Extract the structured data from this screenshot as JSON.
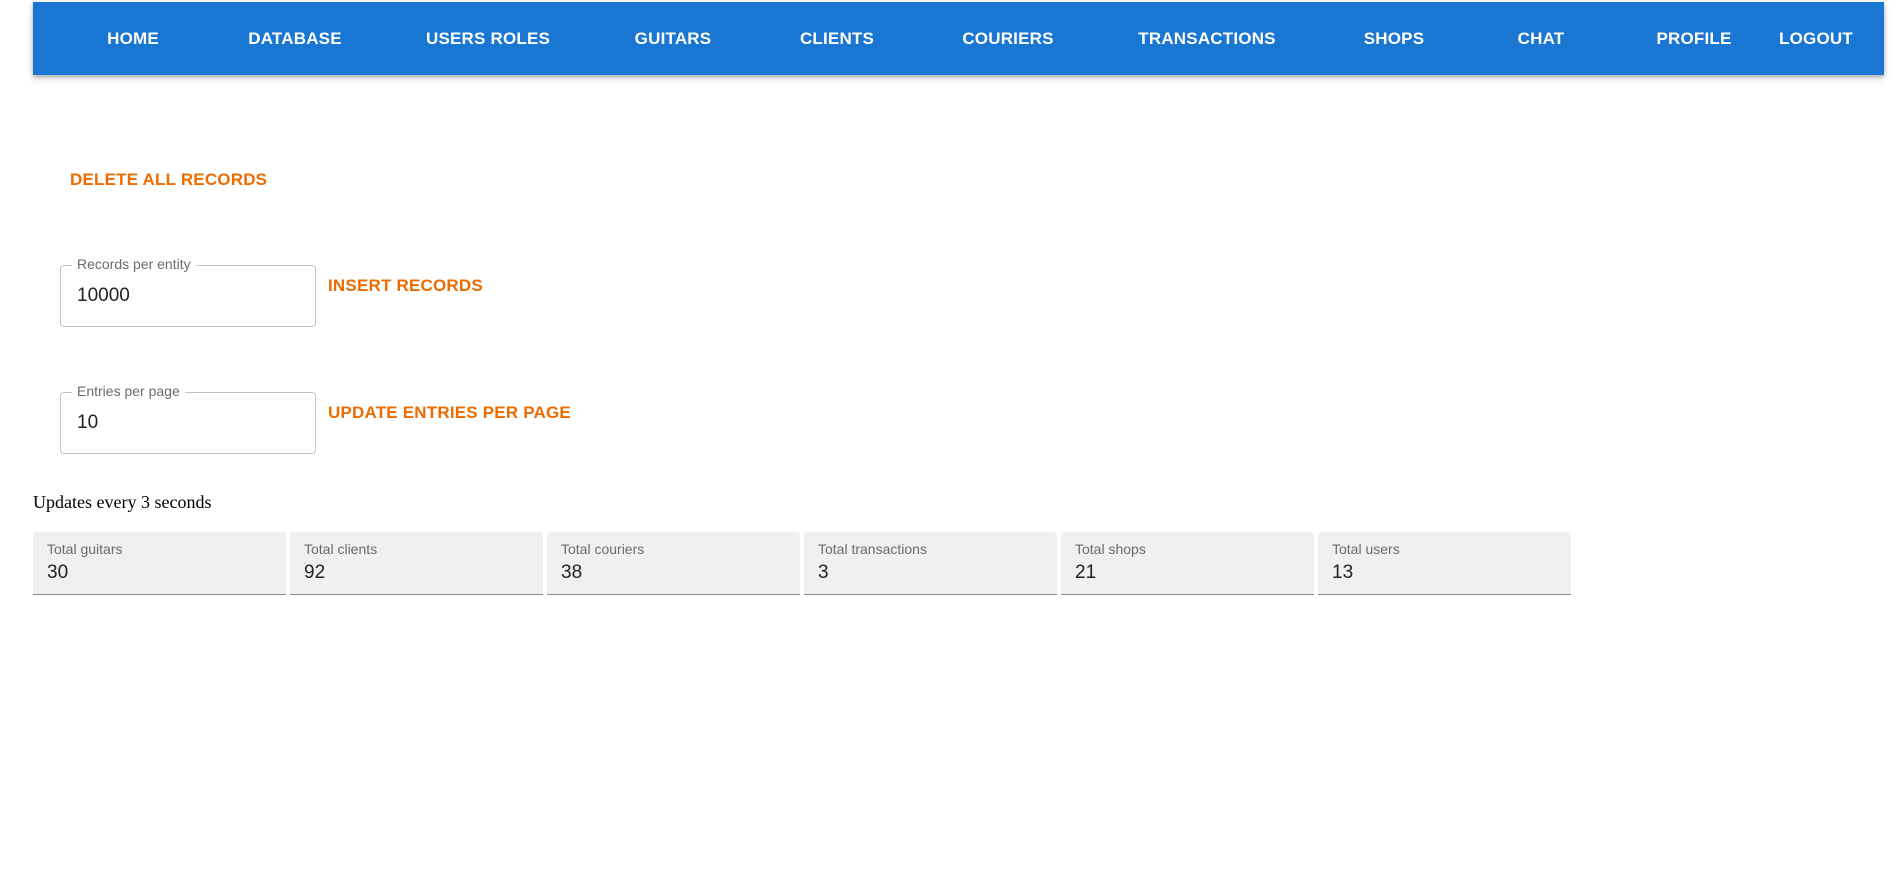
{
  "nav": {
    "items": [
      {
        "label": "HOME"
      },
      {
        "label": "DATABASE"
      },
      {
        "label": "USERS ROLES"
      },
      {
        "label": "GUITARS"
      },
      {
        "label": "CLIENTS"
      },
      {
        "label": "COURIERS"
      },
      {
        "label": "TRANSACTIONS"
      },
      {
        "label": "SHOPS"
      },
      {
        "label": "CHAT"
      },
      {
        "label": "PROFILE"
      },
      {
        "label": "LOGOUT"
      }
    ]
  },
  "actions": {
    "delete_all": "DELETE ALL RECORDS",
    "insert": "INSERT RECORDS",
    "update_entries": "UPDATE ENTRIES PER PAGE"
  },
  "fields": {
    "records_per_entity": {
      "label": "Records per entity",
      "value": "10000"
    },
    "entries_per_page": {
      "label": "Entries per page",
      "value": "10"
    }
  },
  "stats": {
    "note": "Updates every 3 seconds",
    "cards": [
      {
        "label": "Total guitars",
        "value": "30"
      },
      {
        "label": "Total clients",
        "value": "92"
      },
      {
        "label": "Total couriers",
        "value": "38"
      },
      {
        "label": "Total transactions",
        "value": "3"
      },
      {
        "label": "Total shops",
        "value": "21"
      },
      {
        "label": "Total users",
        "value": "13"
      }
    ]
  },
  "colors": {
    "nav_background": "#1976d2",
    "action_text": "#ed6c02",
    "card_background": "#f0f0f0"
  }
}
